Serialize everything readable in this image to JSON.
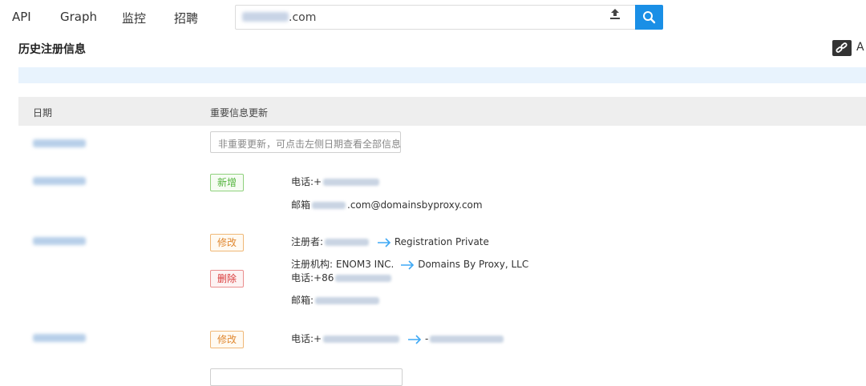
{
  "nav": {
    "items": [
      "API",
      "Graph",
      "监控",
      "招聘"
    ]
  },
  "search": {
    "value_suffix": ".com"
  },
  "section": {
    "title": "历史注册信息",
    "side_label": "A"
  },
  "table": {
    "headers": [
      "日期",
      "重要信息更新"
    ],
    "notice": "非重要更新，可点击左侧日期查看全部信息"
  },
  "rows": {
    "r2": {
      "tag": "新增",
      "phone_label": "电话:+",
      "email_label": "邮箱",
      "email_suffix": ".com@domainsbyproxy.com"
    },
    "r3": {
      "tag_modify": "修改",
      "tag_delete": "删除",
      "registrant_label": "注册者:",
      "registrant_new": "Registration Private",
      "registrar_label": "注册机构: ENOM3 INC.",
      "registrar_new": "Domains By Proxy, LLC",
      "phone_label": "电话:+86",
      "email_label": "邮箱:"
    },
    "r4": {
      "tag": "修改",
      "phone_label": "电话:+",
      "phone_to": "-"
    }
  },
  "colors": {
    "accent": "#1a8fe6",
    "arrow": "#3fa9f5",
    "tag_add": "#52b43c",
    "tag_modify": "#e08830",
    "tag_delete": "#d93a3a"
  }
}
